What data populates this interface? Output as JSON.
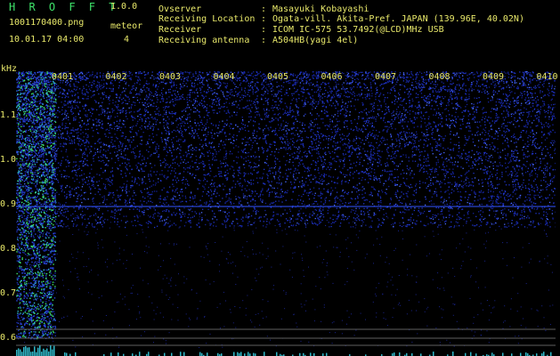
{
  "header": {
    "app_title": "H R O F F T",
    "version": "1.0.0",
    "filename": "1001170400.png",
    "meteor_label": "meteor",
    "timestamp": "10.01.17 04:00",
    "meteor_count": "4"
  },
  "info": [
    {
      "key": "Ovserver",
      "sep": ":",
      "value": "Masayuki Kobayashi"
    },
    {
      "key": "Receiving Location",
      "sep": ":",
      "value": "Ogata-vill. Akita-Pref. JAPAN (139.96E, 40.02N)"
    },
    {
      "key": "Receiver",
      "sep": ":",
      "value": "ICOM IC-575 53.7492(@LCD)MHz USB"
    },
    {
      "key": "Receiving antenna",
      "sep": ":",
      "value": "A504HB(yagi 4el)"
    }
  ],
  "axes": {
    "y_unit": "kHz",
    "y_ticks": [
      "1.1",
      "1.0",
      "0.9",
      "0.8",
      "0.7",
      "0.6"
    ],
    "x_ticks": [
      "0401",
      "0402",
      "0403",
      "0404",
      "0405",
      "0406",
      "0407",
      "0408",
      "0409",
      "0410"
    ]
  },
  "colors": {
    "text": "#e8e86a",
    "title": "#3ee36a",
    "noise": "#1a2fd0",
    "hot": "#3ee36a"
  }
}
